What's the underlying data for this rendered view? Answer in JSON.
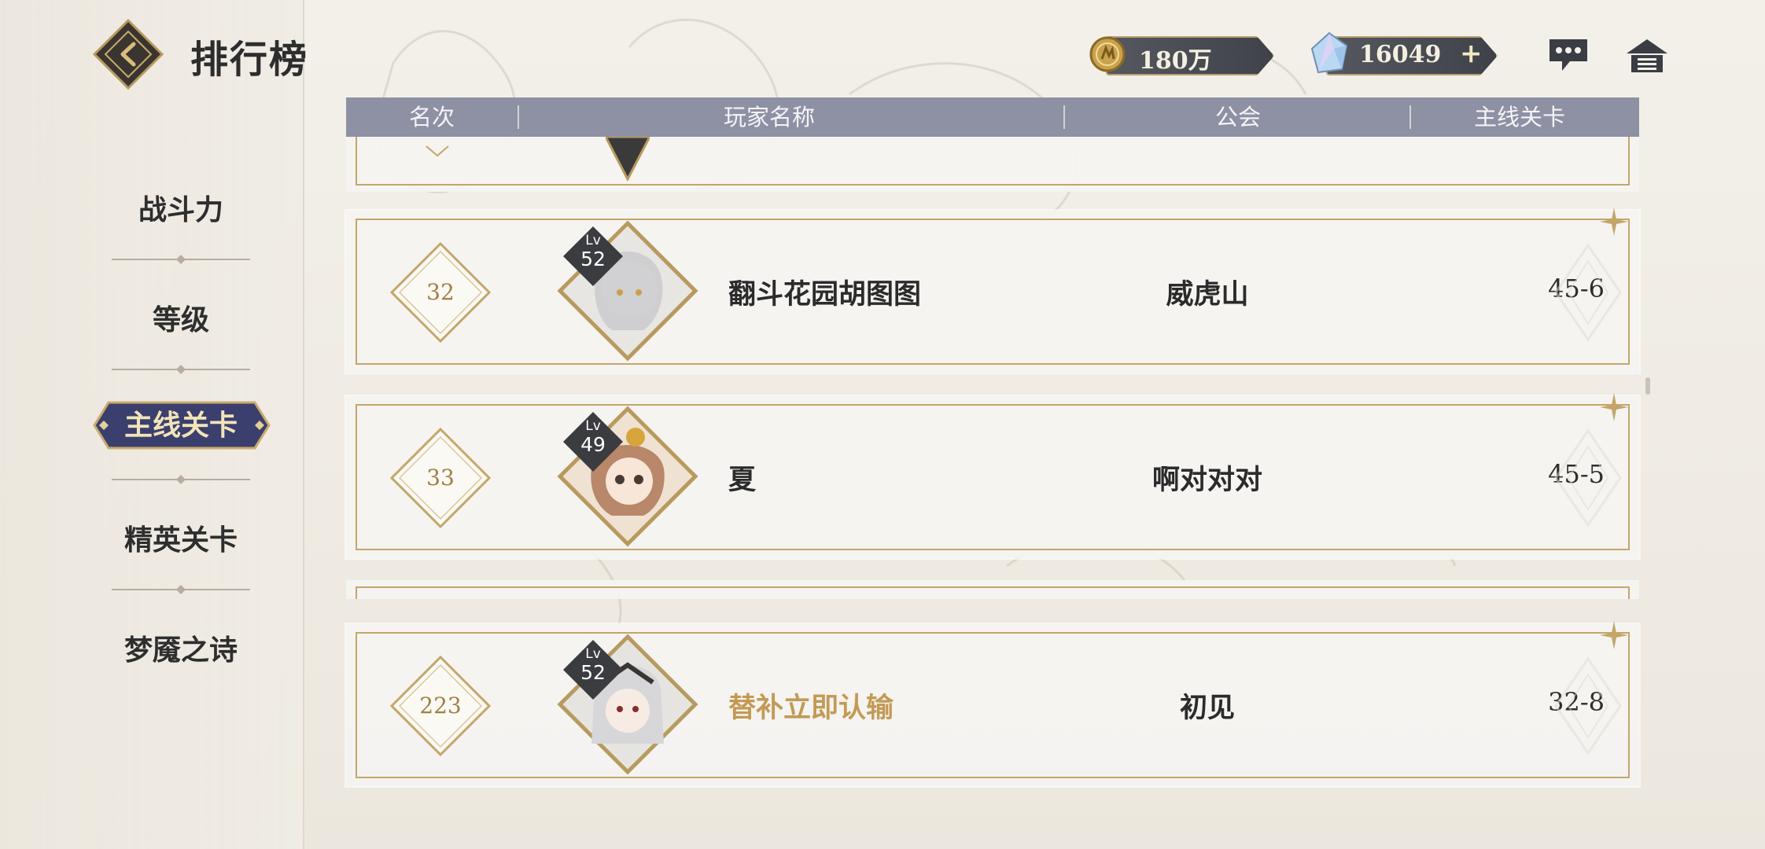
{
  "header": {
    "title": "排行榜",
    "gold": "180万",
    "gems": "16049"
  },
  "nav": {
    "items": [
      {
        "label": "战斗力"
      },
      {
        "label": "等级"
      },
      {
        "label": "主线关卡"
      },
      {
        "label": "精英关卡"
      },
      {
        "label": "梦魇之诗"
      }
    ],
    "active_index": 2
  },
  "table": {
    "columns": [
      "名次",
      "玩家名称",
      "公会",
      "主线关卡"
    ],
    "rows": [
      {
        "rank": "32",
        "lv_label": "Lv",
        "level": "52",
        "name": "翻斗花园胡图图",
        "guild": "威虎山",
        "stage": "45-6",
        "is_self": false
      },
      {
        "rank": "33",
        "lv_label": "Lv",
        "level": "49",
        "name": "夏",
        "guild": "啊对对对",
        "stage": "45-5",
        "is_self": false
      },
      {
        "rank": "223",
        "lv_label": "Lv",
        "level": "52",
        "name": "替补立即认输",
        "guild": "初见",
        "stage": "32-8",
        "is_self": true
      }
    ]
  },
  "colors": {
    "accent_gold": "#c4a66a",
    "header_bar": "#8d91a3",
    "active_tab": "#3b3f6e",
    "self_name": "#c39a55"
  },
  "icons": [
    "back-icon",
    "coin-icon",
    "gem-icon",
    "plus-icon",
    "chat-icon",
    "home-icon"
  ]
}
